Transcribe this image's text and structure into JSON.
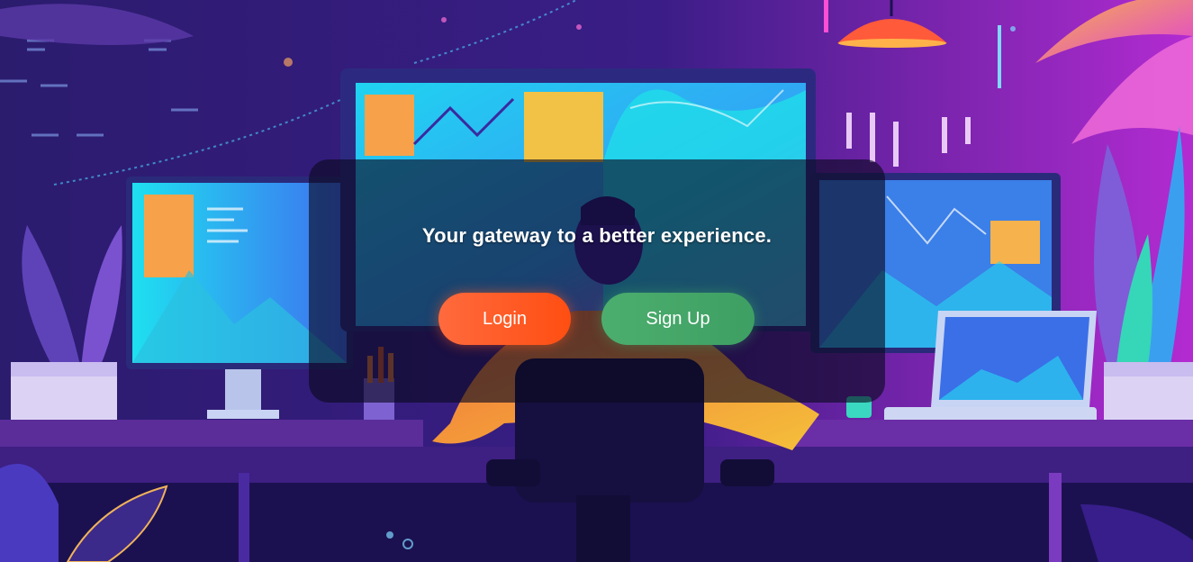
{
  "hero": {
    "tagline": "Your gateway to a better experience.",
    "login_label": "Login",
    "signup_label": "Sign Up"
  },
  "colors": {
    "login_button": "#ff5a22",
    "signup_button": "#45a868",
    "panel_overlay": "rgba(10,8,30,0.62)",
    "background_primary": "#2a1566",
    "background_accent": "#c12fd8"
  },
  "background": {
    "description_icon": "developer-workspace-illustration"
  }
}
